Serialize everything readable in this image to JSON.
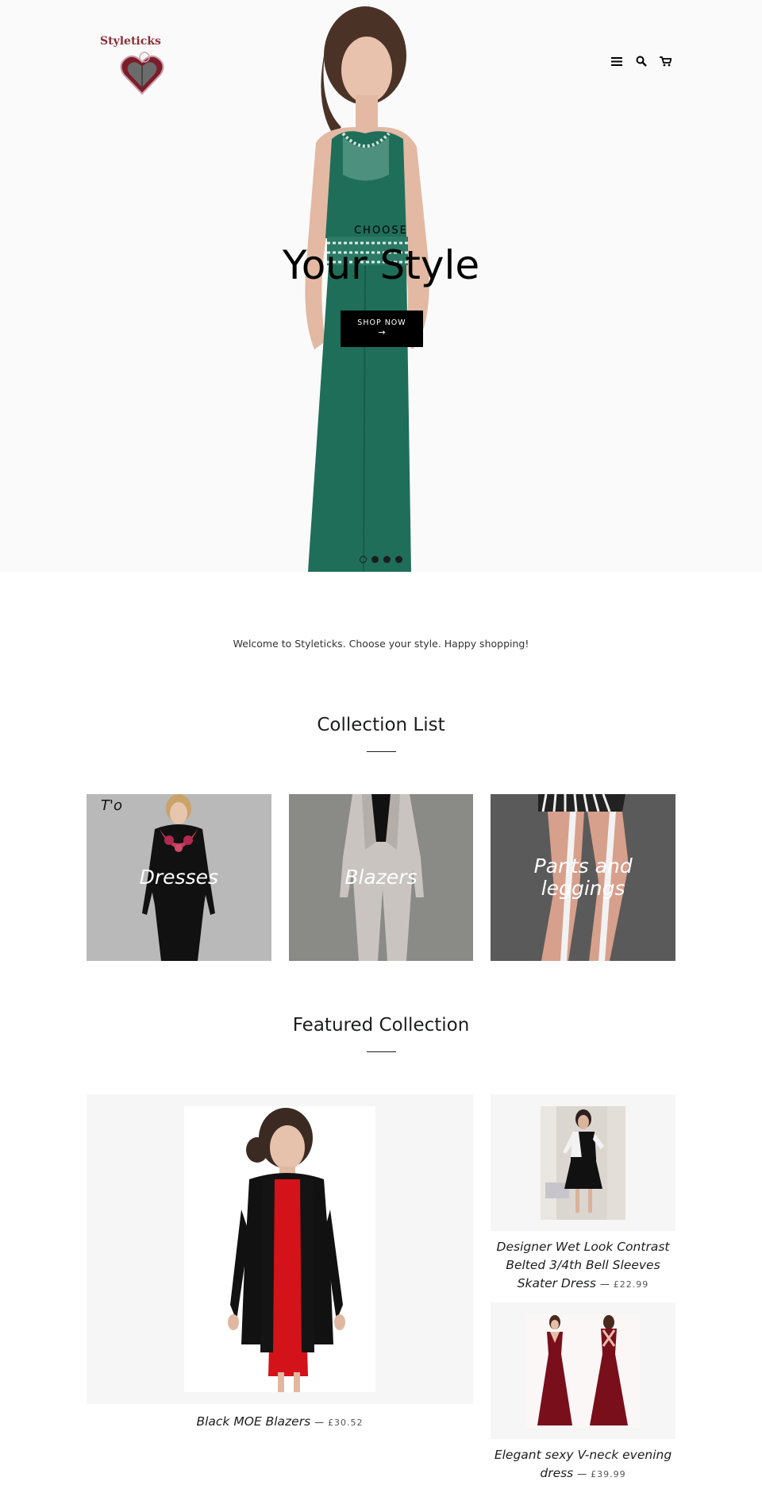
{
  "header": {
    "logo_text": "Styleticks",
    "icons": [
      "menu-icon",
      "search-icon",
      "cart-icon"
    ]
  },
  "hero": {
    "kicker": "CHOOSE",
    "title": "Your Style",
    "button_label": "SHOP NOW",
    "button_arrow": "→",
    "slides_count": 4,
    "active_slide": 1
  },
  "welcome_text": "Welcome to Styleticks. Choose your style. Happy shopping!",
  "collection_list": {
    "title": "Collection List",
    "items": [
      {
        "label": "Dresses",
        "bg": "#b9b9b9"
      },
      {
        "label": "Blazers",
        "bg": "#8a8a87"
      },
      {
        "label": "Pants and leggings",
        "bg": "#5b5a5b"
      }
    ],
    "dresses_overlay_text": "T'o"
  },
  "featured": {
    "title": "Featured Collection",
    "products": [
      {
        "name": "Black MOE Blazers",
        "separator": "—",
        "price": "£30.52"
      },
      {
        "name": "Designer Wet Look Contrast Belted 3/4th Bell Sleeves Skater Dress",
        "separator": "—",
        "price": "£22.99"
      },
      {
        "name": "Elegant sexy V-neck evening dress",
        "separator": "—",
        "price": "£39.99"
      }
    ]
  },
  "colors": {
    "dress_green": "#1f6e5a",
    "accent_black": "#000000",
    "logo_red": "#8a2f3a",
    "tile_bg": "#f6f6f6"
  }
}
